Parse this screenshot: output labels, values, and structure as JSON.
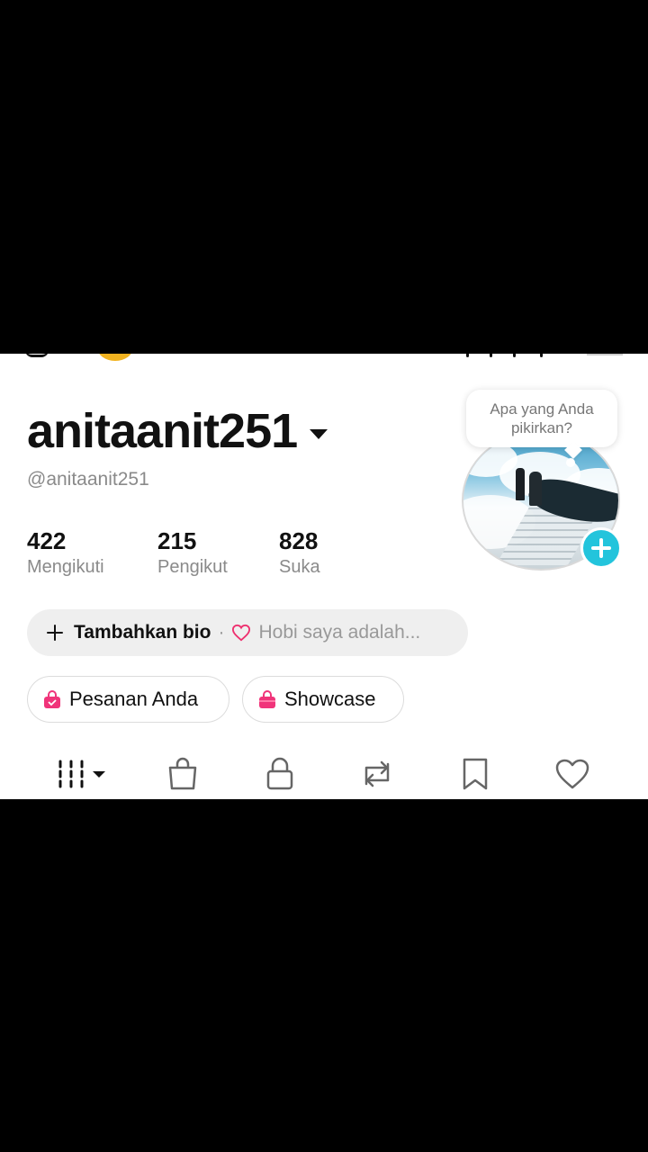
{
  "profile": {
    "username": "anitaanit251",
    "handle": "@anitaanit251"
  },
  "stats": [
    {
      "value": "422",
      "label": "Mengikuti"
    },
    {
      "value": "215",
      "label": "Pengikut"
    },
    {
      "value": "828",
      "label": "Suka"
    }
  ],
  "avatar": {
    "bubble_text": "Apa yang Anda pikirkan?"
  },
  "bio": {
    "label": "Tambahkan bio",
    "separator": "·",
    "hint": "Hobi saya adalah..."
  },
  "shop_buttons": {
    "orders_label": "Pesanan Anda",
    "showcase_label": "Showcase"
  },
  "tabs": [
    {
      "icon": "videos-grid-icon"
    },
    {
      "icon": "shopping-bag-icon"
    },
    {
      "icon": "lock-icon"
    },
    {
      "icon": "repost-icon"
    },
    {
      "icon": "bookmark-icon"
    },
    {
      "icon": "heart-icon"
    }
  ],
  "colors": {
    "accent_cyan": "#23c4dc",
    "shop_pink": "#f0347a",
    "heart_pink": "#ee2f6e"
  }
}
